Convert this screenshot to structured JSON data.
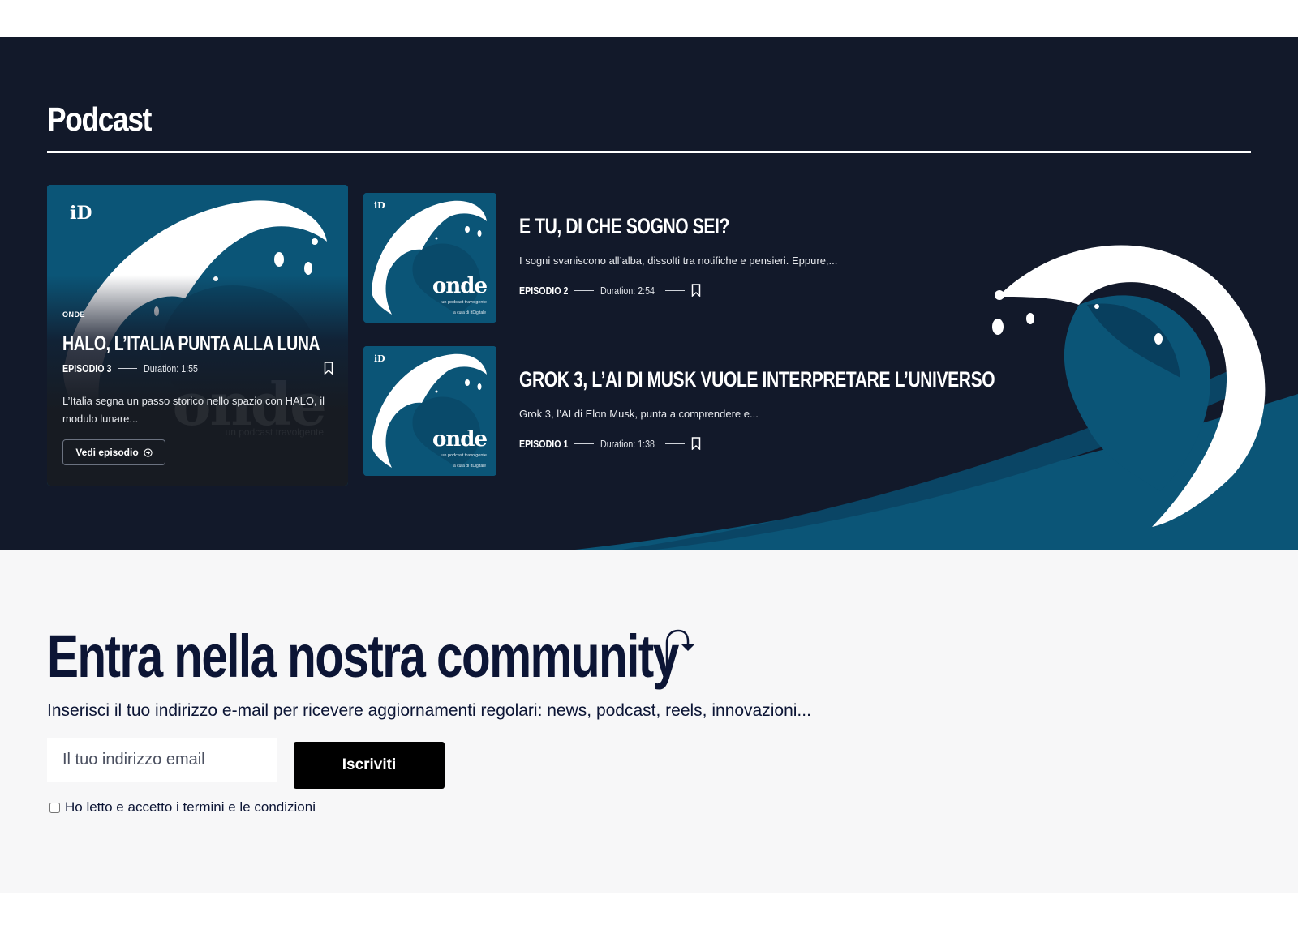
{
  "podcast": {
    "section_title": "Podcast",
    "featured": {
      "logo": "iD",
      "kicker": "ONDE",
      "brand_ghost": "onde",
      "brand_ghost_sub": "un podcast travolgente",
      "title": "HALO, L’ITALIA PUNTA ALLA LUNA",
      "episode": "EPISODIO 3",
      "duration": "Duration: 1:55",
      "excerpt": "L’Italia segna un passo storico nello spazio con HALO, il modulo lunare...",
      "cta_label": "Vedi episodio"
    },
    "episodes": [
      {
        "logo": "iD",
        "brand": "onde",
        "brand_sub": "un podcast travolgente",
        "credit": "a cura di ItDigitale",
        "title": "E TU, DI CHE SOGNO SEI?",
        "excerpt": "I sogni svaniscono all’alba, dissolti tra notifiche e pensieri. Eppure,...",
        "episode": "EPISODIO 2",
        "duration": "Duration: 2:54"
      },
      {
        "logo": "iD",
        "brand": "onde",
        "brand_sub": "un podcast travolgente",
        "credit": "a cura di ItDigitale",
        "title": "GROK 3, L’AI DI MUSK VUOLE INTERPRETARE L’UNIVERSO",
        "excerpt": "Grok 3, l’AI di Elon Musk, punta a comprendere e...",
        "episode": "EPISODIO 1",
        "duration": "Duration: 1:38"
      }
    ]
  },
  "community": {
    "title": "Entra nella nostra community",
    "subtitle": "Inserisci il tuo indirizzo e-mail per ricevere aggiornamenti regolari: news, podcast, reels, innovazioni...",
    "email_placeholder": "Il tuo indirizzo email",
    "subscribe_label": "Iscriviti",
    "terms_label": "Ho letto e accetto i termini e le condizioni"
  },
  "colors": {
    "navy": "#12192a",
    "wave_blue": "#0b5577",
    "community_text": "#0c1535",
    "community_bg": "#f7f7f8"
  }
}
